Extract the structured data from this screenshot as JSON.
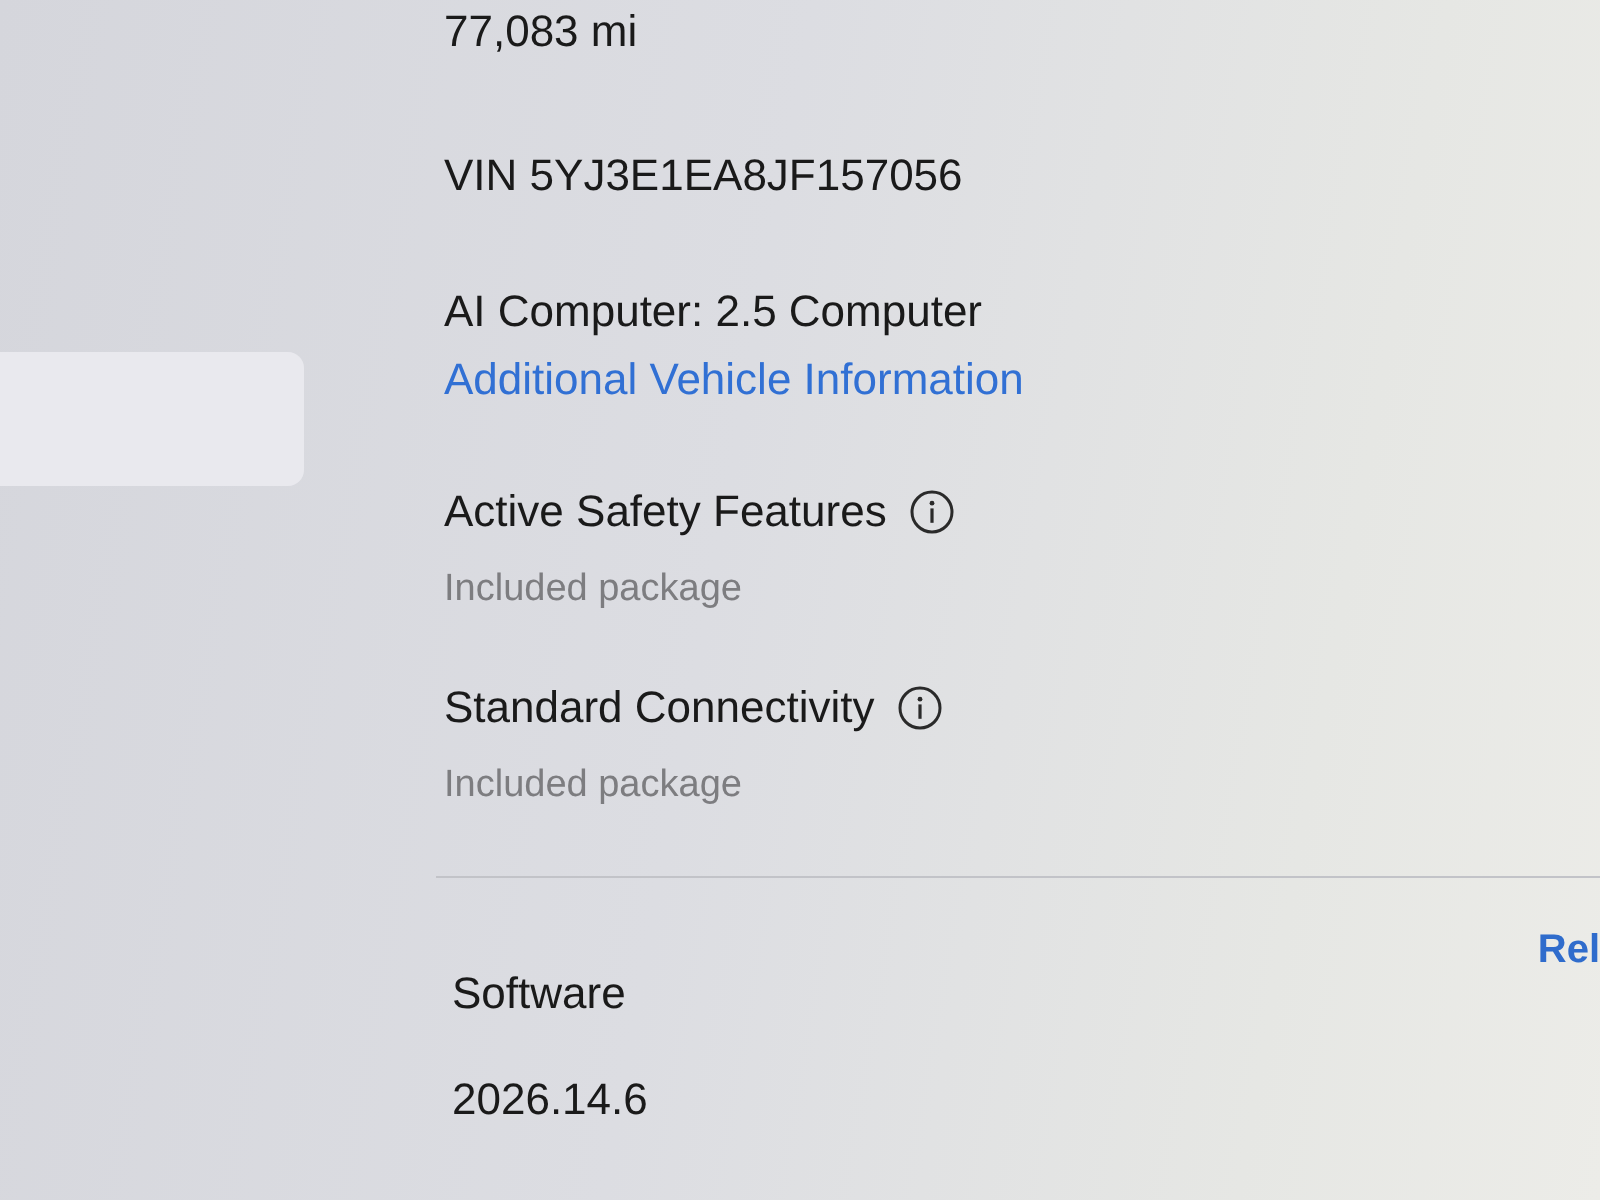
{
  "sidebar": {
    "items": [
      {
        "selected": true
      }
    ]
  },
  "vehicle": {
    "odometer": "77,083 mi",
    "vin": "VIN 5YJ3E1EA8JF157056",
    "ai_computer": "AI Computer: 2.5 Computer",
    "link": "Additional Vehicle Information"
  },
  "features": [
    {
      "title": "Active Safety Features",
      "note": "Included package"
    },
    {
      "title": "Standard Connectivity",
      "note": "Included package"
    }
  ],
  "software": {
    "link": "Rel",
    "label": "Software",
    "version": "2026.14.6"
  }
}
